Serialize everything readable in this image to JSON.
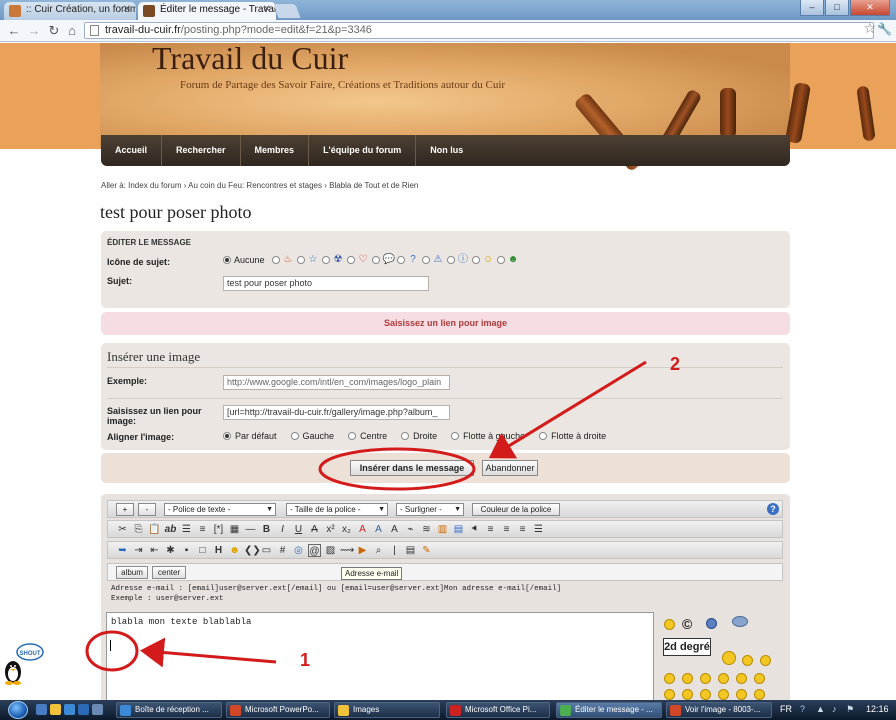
{
  "browser": {
    "tabs": [
      {
        "title": ":: Cuir Création, un forum",
        "active": false
      },
      {
        "title": "Éditer le message - Travai",
        "active": true
      }
    ],
    "url_host": "travail-du-cuir.fr",
    "url_path": "/posting.php?mode=edit&f=21&p=3346"
  },
  "site": {
    "title": "Travail du Cuir",
    "subtitle": "Forum de Partage des Savoir Faire, Créations et Traditions autour du Cuir"
  },
  "menu": [
    "Accueil",
    "Rechercher",
    "Membres",
    "L'équipe du forum",
    "Non lus"
  ],
  "breadcrumb": "Aller à: Index du forum › Au coin du Feu: Rencontres et stages › Blabla de Tout et de Rien",
  "page_title": "test pour poser photo",
  "edit_panel": {
    "heading": "ÉDITER LE MESSAGE",
    "icon_label": "Icône de sujet:",
    "icon_none": "Aucune",
    "subject_label": "Sujet:",
    "subject_value": "test pour poser photo"
  },
  "info_bar": "Saisissez un lien pour image",
  "image_panel": {
    "heading": "Insérer une image",
    "example_label": "Exemple:",
    "example_value": "http://www.google.com/intl/en_com/images/logo_plain",
    "link_label": "Saisissez un lien pour image:",
    "link_value": "[url=http://travail-du-cuir.fr/gallery/image.php?album_",
    "align_label": "Aligner l'image:",
    "align_options": [
      "Par défaut",
      "Gauche",
      "Centre",
      "Droite",
      "Flotte à gauche",
      "Flotte à droite"
    ]
  },
  "actions": {
    "insert": "Insérer dans le message",
    "cancel": "Abandonner"
  },
  "editor": {
    "font_select": "- Police de texte -",
    "size_select": "- Taille de la police -",
    "highlight_select": "- Surligner -",
    "color_button": "Couleur de la police",
    "custom_btn_1": "album",
    "custom_btn_2": "center",
    "tooltip": "Adresse e-mail",
    "hint_line1": "Adresse e-mail : [email]user@server.ext[/email] ou [email=user@server.ext]Mon adresse e-mail[/email]",
    "hint_line2": "Exemple : user@server.ext",
    "text": "blabla mon texte blablabla",
    "degree_badge": "2d degré"
  },
  "annotations": {
    "one": "1",
    "two": "2"
  },
  "taskbar": {
    "items": [
      "Boîte de réception ...",
      "Microsoft PowerPo...",
      "Images",
      "Microsoft Office Pi...",
      "Éditer le message - ...",
      "Voir l'image - 8003-..."
    ],
    "lang": "FR",
    "time": "12:16"
  },
  "colors": {
    "accent_red": "#d31b1b",
    "menu_bg": "#3a3027",
    "header_orange": "#eaa25a"
  }
}
